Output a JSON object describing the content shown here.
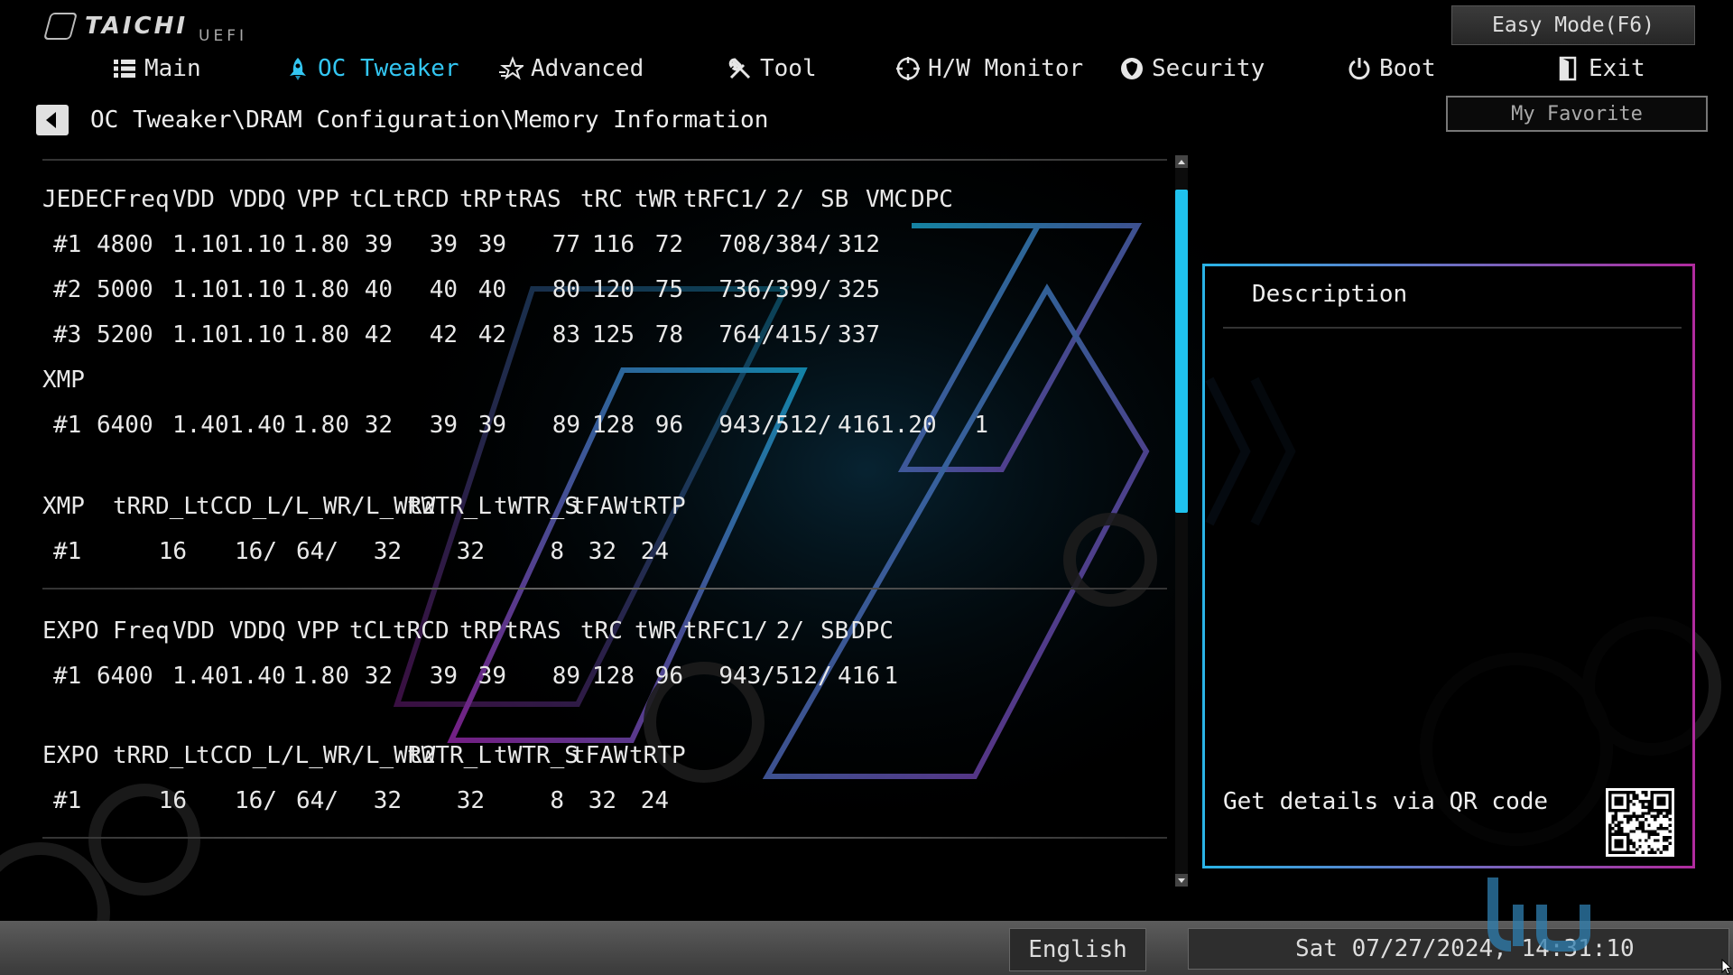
{
  "header": {
    "brand": "TAICHI",
    "brand_suffix": "UEFI",
    "easy_mode_label": "Easy Mode(F6)",
    "favorite_label": "My Favorite"
  },
  "nav": {
    "active": "OC Tweaker",
    "items": [
      {
        "label": "Main",
        "icon": "list-icon"
      },
      {
        "label": "OC Tweaker",
        "icon": "rocket-icon"
      },
      {
        "label": "Advanced",
        "icon": "star-icon"
      },
      {
        "label": "Tool",
        "icon": "tools-icon"
      },
      {
        "label": "H/W Monitor",
        "icon": "monitor-icon"
      },
      {
        "label": "Security",
        "icon": "shield-icon"
      },
      {
        "label": "Boot",
        "icon": "power-icon"
      },
      {
        "label": "Exit",
        "icon": "exit-icon"
      }
    ]
  },
  "breadcrumb": "OC Tweaker\\DRAM Configuration\\Memory Information",
  "memory_info": {
    "jedec_header": [
      "JEDEC",
      "Freq",
      "VDD",
      "VDDQ",
      "VPP",
      "tCL",
      "tRCD",
      "tRP",
      "tRAS",
      "tRC",
      "tWR",
      "tRFC1/",
      "2/",
      "SB",
      "VMC",
      "DPC"
    ],
    "jedec_rows": [
      [
        "#1",
        "4800",
        "1.10",
        "1.10",
        "1.80",
        "39",
        "39",
        "39",
        "77",
        "116",
        "72",
        "708/",
        "384/",
        "312",
        "",
        ""
      ],
      [
        "#2",
        "5000",
        "1.10",
        "1.10",
        "1.80",
        "40",
        "40",
        "40",
        "80",
        "120",
        "75",
        "736/",
        "399/",
        "325",
        "",
        ""
      ],
      [
        "#3",
        "5200",
        "1.10",
        "1.10",
        "1.80",
        "42",
        "42",
        "42",
        "83",
        "125",
        "78",
        "764/",
        "415/",
        "337",
        "",
        ""
      ]
    ],
    "xmp_label": "XMP",
    "xmp_rows": [
      [
        "#1",
        "6400",
        "1.40",
        "1.40",
        "1.80",
        "32",
        "39",
        "39",
        "89",
        "128",
        "96",
        "943/",
        "512/",
        "416",
        "1.20",
        "1"
      ]
    ],
    "xmp_timing_header": [
      "XMP",
      "tRRD_L",
      "tCCD_L/L_WR/L_WR2",
      "tWTR_L",
      "tWTR_S",
      "tFAW",
      "tRTP"
    ],
    "xmp_timing_rows": [
      [
        "#1",
        "16",
        "16/",
        "64/",
        "32",
        "32",
        "8",
        "32",
        "24"
      ]
    ],
    "expo_header": [
      "EXPO",
      "Freq",
      "VDD",
      "VDDQ",
      "VPP",
      "tCL",
      "tRCD",
      "tRP",
      "tRAS",
      "tRC",
      "tWR",
      "tRFC1/",
      "2/",
      "SB",
      "DPC"
    ],
    "expo_rows": [
      [
        "#1",
        "6400",
        "1.40",
        "1.40",
        "1.80",
        "32",
        "39",
        "39",
        "89",
        "128",
        "96",
        "943/",
        "512/",
        "416",
        "1"
      ]
    ],
    "expo_timing_header": [
      "EXPO",
      "tRRD_L",
      "tCCD_L/L_WR/L_WR2",
      "tWTR_L",
      "tWTR_S",
      "tFAW",
      "tRTP"
    ],
    "expo_timing_rows": [
      [
        "#1",
        "16",
        "16/",
        "64/",
        "32",
        "32",
        "8",
        "32",
        "24"
      ]
    ]
  },
  "description": {
    "title": "Description",
    "qr_label": "Get details via QR code"
  },
  "footer": {
    "language": "English",
    "datetime": "Sat 07/27/2024, 14:31:10"
  },
  "colors": {
    "accent": "#33c6f2",
    "panel_gradient_start": "#2ab3e6",
    "panel_gradient_end": "#b02b9e"
  }
}
